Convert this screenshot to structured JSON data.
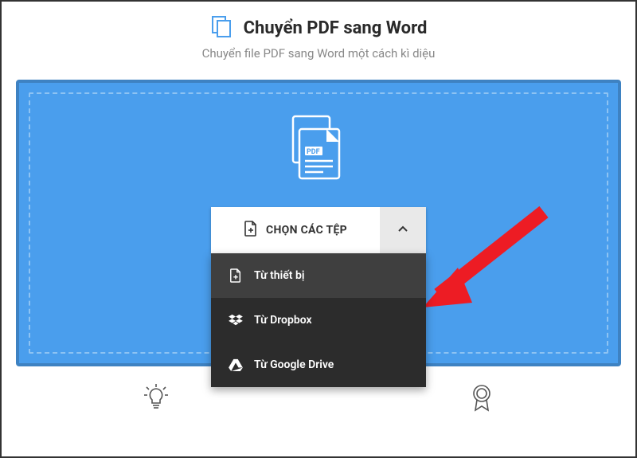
{
  "header": {
    "title": "Chuyển PDF sang Word",
    "subtitle": "Chuyển file PDF sang Word một cách kì diệu"
  },
  "colors": {
    "panel_bg": "#4a9eed",
    "panel_border": "#3e82c2",
    "menu_bg": "#2c2c2c",
    "menu_bg_first": "#3f3f3f",
    "arrow": "#ed1c24"
  },
  "picker": {
    "choose_label": "CHỌN CÁC TỆP",
    "menu": [
      {
        "label": "Từ thiết bị",
        "icon": "file-add"
      },
      {
        "label": "Từ Dropbox",
        "icon": "dropbox"
      },
      {
        "label": "Từ Google Drive",
        "icon": "google-drive"
      }
    ]
  }
}
